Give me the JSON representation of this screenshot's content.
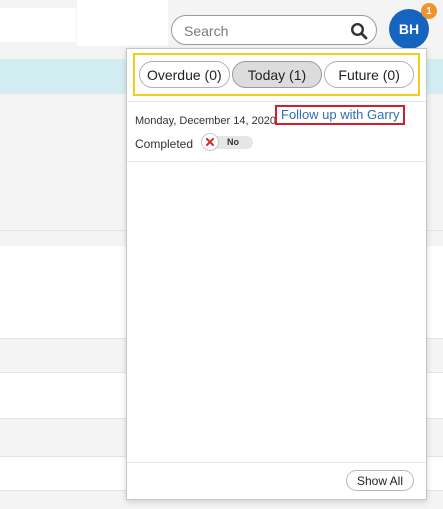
{
  "search": {
    "placeholder": "Search"
  },
  "user": {
    "initials": "BH",
    "notification_count": "1"
  },
  "colors": {
    "avatar": "#1565c0",
    "badge": "#f0932b",
    "tab_highlight": "#f2cd1a",
    "task_highlight": "#d0202a",
    "link": "#2f6fb3",
    "toggle_off_icon": "#d32f2f"
  },
  "tasks_panel": {
    "tabs": [
      {
        "label": "Overdue (0)",
        "selected": false
      },
      {
        "label": "Today (1)",
        "selected": true
      },
      {
        "label": "Future (0)",
        "selected": false
      }
    ],
    "items": [
      {
        "date": "Monday, December 14, 2020",
        "title": "Follow up with Garry",
        "completed_label": "Completed",
        "completed_state": "No",
        "completed": false
      }
    ],
    "show_all_label": "Show All"
  },
  "icons": {
    "search": "search-icon",
    "toggle_off": "close-icon"
  }
}
